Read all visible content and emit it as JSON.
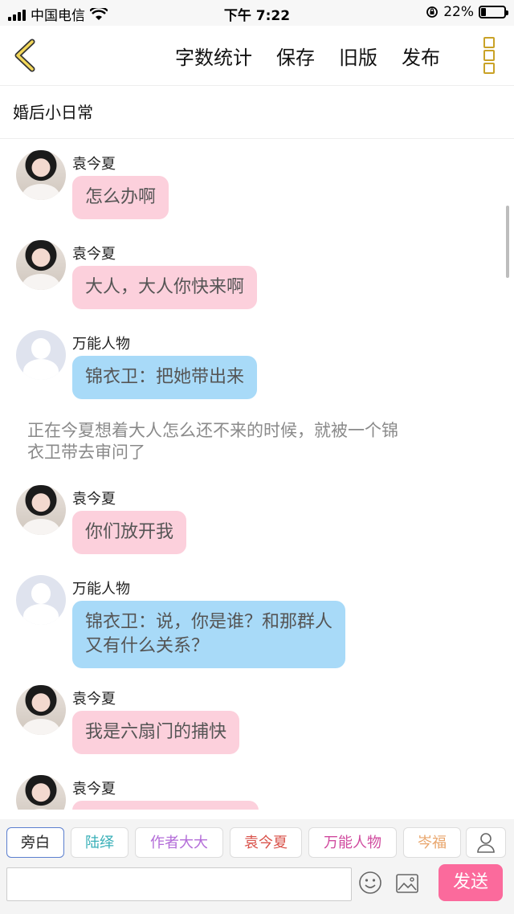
{
  "status_bar": {
    "carrier": "中国电信",
    "time": "下午 7:22",
    "battery": "22%",
    "battery_level": 0.22
  },
  "nav": {
    "back_icon": "chevron-left-icon",
    "actions": [
      "字数统计",
      "保存",
      "旧版",
      "发布"
    ],
    "more_icon": "more-vertical-icon"
  },
  "doc_title": "婚后小日常",
  "messages": [
    {
      "type": "dialog",
      "speaker": "袁今夏",
      "text": "怎么办啊",
      "color": "#fcd0dc"
    },
    {
      "type": "dialog",
      "speaker": "袁今夏",
      "text": "大人，大人你快来啊",
      "color": "#fcd0dc"
    },
    {
      "type": "dialog",
      "speaker": "万能人物",
      "text": "锦衣卫：把她带出来",
      "color": "#a8daf8"
    },
    {
      "type": "narration",
      "text_line1": "正在今夏想着大人怎么还不来的时候，就被一个锦",
      "text_line2": "衣卫带去审问了"
    },
    {
      "type": "dialog",
      "speaker": "袁今夏",
      "text": "你们放开我",
      "color": "#fcd0dc"
    },
    {
      "type": "dialog",
      "speaker": "万能人物",
      "text_line1": "锦衣卫：说，你是谁？和那群人",
      "text_line2": "又有什么关系？",
      "color": "#a8daf8"
    },
    {
      "type": "dialog",
      "speaker": "袁今夏",
      "text": "我是六扇门的捕快",
      "color": "#fcd0dc"
    },
    {
      "type": "dialog",
      "speaker": "袁今夏",
      "text": "",
      "color": "#fcd0dc"
    }
  ],
  "roles": [
    {
      "label": "旁白",
      "color": "#222222",
      "active": true
    },
    {
      "label": "陆绎",
      "color": "#3ab0b8"
    },
    {
      "label": "作者大大",
      "color": "#b36cd8"
    },
    {
      "label": "袁今夏",
      "color": "#d9524a"
    },
    {
      "label": "万能人物",
      "color": "#d04a9e"
    },
    {
      "label": "岑福",
      "color": "#e8a46a"
    }
  ],
  "input": {
    "placeholder": "",
    "emoji_icon": "emoji-icon",
    "image_icon": "image-icon",
    "send_label": "发送"
  }
}
